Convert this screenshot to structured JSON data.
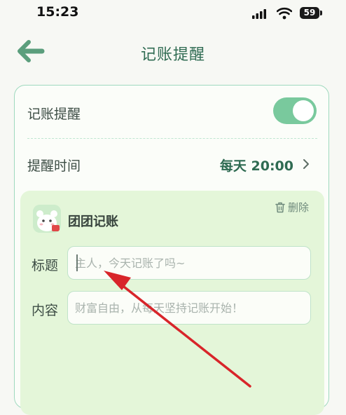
{
  "status_bar": {
    "time": "15:23",
    "battery": "59"
  },
  "header": {
    "title": "记账提醒"
  },
  "settings": {
    "reminder_toggle_label": "记账提醒",
    "reminder_enabled": true,
    "time_label": "提醒时间",
    "time_value": "每天 20:00"
  },
  "reminder": {
    "app_name": "团团记账",
    "delete_label": "删除",
    "title_label": "标题",
    "title_placeholder": "主人，今天记账了吗~",
    "content_label": "内容",
    "content_placeholder": "财富自由，从每天坚持记账开始！"
  },
  "colors": {
    "accent": "#79c99d",
    "title": "#2f6b52",
    "panel": "#e4f6d9",
    "arrow": "#d8252a"
  }
}
